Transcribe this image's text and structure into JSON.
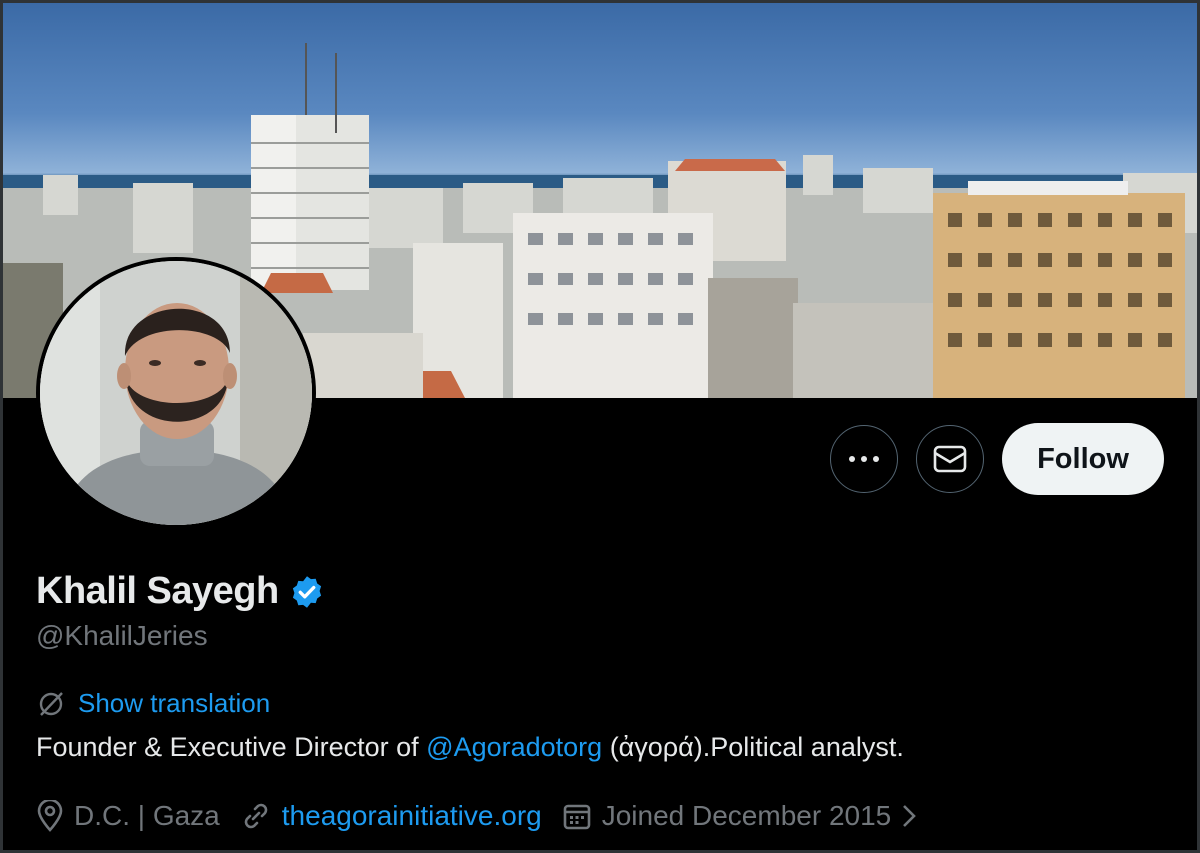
{
  "profile": {
    "name": "Khalil Sayegh",
    "handle": "@KhalilJeries",
    "verified": true,
    "show_translation": "Show translation",
    "bio_prefix": "Founder & Executive Director of ",
    "bio_mention": "@Agoradotorg",
    "bio_suffix": " (ἀγορά).Political analyst.",
    "location": "D.C. | Gaza",
    "website": "theagorainitiative.org",
    "joined": "Joined December 2015"
  },
  "actions": {
    "more_icon": "more-icon",
    "message_icon": "envelope-icon",
    "follow_label": "Follow"
  },
  "colors": {
    "background": "#000000",
    "accent": "#1d9bf0",
    "muted": "#71767b",
    "follow_bg": "#eff3f4"
  }
}
